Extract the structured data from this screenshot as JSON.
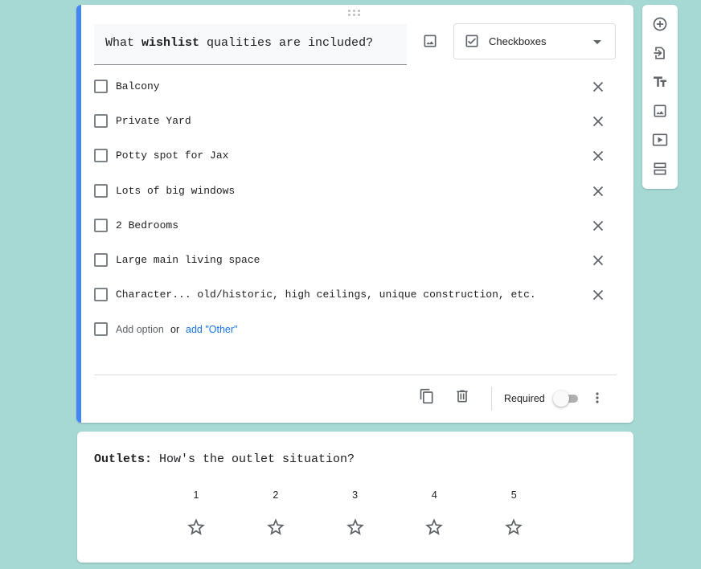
{
  "question": {
    "title_prefix": "What ",
    "title_bold": "wishlist",
    "title_suffix": " qualities are included?",
    "type_label": "Checkboxes",
    "options": [
      "Balcony",
      "Private Yard",
      "Potty spot for Jax",
      "Lots of big windows",
      "2 Bedrooms",
      "Large main living space",
      "Character... old/historic, high ceilings, unique construction, etc."
    ],
    "add_option_label": "Add option",
    "or_label": "or",
    "add_other_label": "add \"Other\"",
    "required_label": "Required",
    "required": false
  },
  "side_toolbar": {
    "tools": [
      "add-question-icon",
      "import-questions-icon",
      "add-title-icon",
      "add-image-icon",
      "add-video-icon",
      "add-section-icon"
    ]
  },
  "rating_question": {
    "title_bold": "Outlets:",
    "title_rest": " How's the outlet situation?",
    "scale": [
      "1",
      "2",
      "3",
      "4",
      "5"
    ]
  },
  "colors": {
    "background": "#a6d9d4",
    "accent": "#4285f4",
    "link": "#1a73e8"
  }
}
